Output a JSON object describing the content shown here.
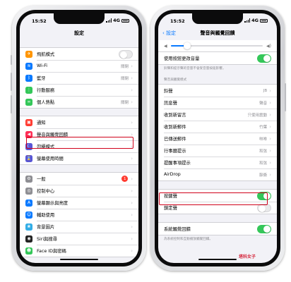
{
  "left": {
    "time": "15:52",
    "network": "4G",
    "title": "設定",
    "group1": [
      {
        "label": "飛航模式",
        "icon": "airplane-icon",
        "color": "#ff9500",
        "glyph": "✈",
        "type": "toggle"
      },
      {
        "label": "Wi-Fi",
        "icon": "wifi-icon",
        "color": "#0a7aff",
        "glyph": "≋",
        "value": "關閉"
      },
      {
        "label": "藍牙",
        "icon": "bluetooth-icon",
        "color": "#0a7aff",
        "glyph": "ᛒ",
        "value": "關閉"
      },
      {
        "label": "行動服務",
        "icon": "cellular-icon",
        "color": "#34c759",
        "glyph": "⋮"
      },
      {
        "label": "個人熱點",
        "icon": "hotspot-icon",
        "color": "#34c759",
        "glyph": "∞",
        "value": "關閉"
      }
    ],
    "group2": [
      {
        "label": "通知",
        "icon": "notifications-icon",
        "color": "#ff3b30",
        "glyph": "▣"
      },
      {
        "label": "聲音與觸覺回饋",
        "icon": "sounds-icon",
        "color": "#ff2d55",
        "glyph": "◀"
      },
      {
        "label": "勿擾模式",
        "icon": "moon-icon",
        "color": "#5856d6",
        "glyph": "☾"
      },
      {
        "label": "螢幕使用時間",
        "icon": "hourglass-icon",
        "color": "#5856d6",
        "glyph": "⌛"
      }
    ],
    "group3": [
      {
        "label": "一般",
        "icon": "gear-icon",
        "color": "#8e8e93",
        "glyph": "⚙",
        "badge": "1"
      },
      {
        "label": "控制中心",
        "icon": "control-center-icon",
        "color": "#8e8e93",
        "glyph": "◎"
      },
      {
        "label": "螢幕顯示與亮度",
        "icon": "display-icon",
        "color": "#0a7aff",
        "glyph": "A"
      },
      {
        "label": "輔助使用",
        "icon": "accessibility-icon",
        "color": "#0a7aff",
        "glyph": "☺"
      },
      {
        "label": "背景圖片",
        "icon": "wallpaper-icon",
        "color": "#32ade6",
        "glyph": "❀"
      },
      {
        "label": "Siri與搜尋",
        "icon": "siri-icon",
        "color": "#222222",
        "glyph": "◉"
      },
      {
        "label": "Face ID與密碼",
        "icon": "faceid-icon",
        "color": "#34c759",
        "glyph": "☻"
      }
    ]
  },
  "right": {
    "time": "15:52",
    "network": "4G",
    "back_label": "設定",
    "title": "聲音與觸覺回饋",
    "volume_fraction": 0.18,
    "change_with_buttons": {
      "label": "使用按鈕更改音量",
      "on": true
    },
    "change_footnote": "鈴聲和提示聲的音量不會受音量按鈕影響。",
    "section_header": "聲音與觸覺模式",
    "tones": [
      {
        "label": "鈴聲",
        "value": "JB"
      },
      {
        "label": "訊息聲",
        "value": "聲音"
      },
      {
        "label": "收到新留言",
        "value": "只使用震動"
      },
      {
        "label": "收到新郵件",
        "value": "竹葉"
      },
      {
        "label": "已傳送郵件",
        "value": "咻咻"
      },
      {
        "label": "行事曆提示",
        "value": "和弦"
      },
      {
        "label": "提醒事項提示",
        "value": "和弦"
      },
      {
        "label": "AirDrop",
        "value": "脈衝"
      }
    ],
    "keyboard_clicks": {
      "label": "按鍵聲",
      "on": true
    },
    "lock_sound": {
      "label": "鎖定聲",
      "on": false
    },
    "system_haptics": {
      "label": "系統觸覺回饋",
      "on": true
    },
    "haptics_footnote": "為系統控制和互動播放觸覺回饋。",
    "watermark": "塔科女子"
  },
  "highlight_color": "#d0021b"
}
